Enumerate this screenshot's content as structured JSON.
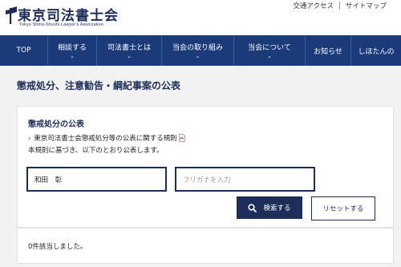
{
  "header": {
    "logo_title": "東京司法書士会",
    "logo_subtitle": "Tokyo Shiho-Shoshi Lawyer's Association",
    "util_links": [
      "交通アクセス",
      "サイトマップ"
    ]
  },
  "nav": {
    "items": [
      {
        "label": "TOP",
        "has_dropdown": false
      },
      {
        "label": "相談する",
        "has_dropdown": true
      },
      {
        "label": "司法書士とは",
        "has_dropdown": true
      },
      {
        "label": "当会の取り組み",
        "has_dropdown": true
      },
      {
        "label": "当会について",
        "has_dropdown": true
      },
      {
        "label": "お知らせ",
        "has_dropdown": false
      },
      {
        "label": "しほたんの",
        "has_dropdown": false
      }
    ],
    "chevron": "⌄"
  },
  "main": {
    "page_title": "懲戒処分、注意勧告・綱紀事案の公表",
    "section_title": "懲戒処分の公表",
    "rule_link": "東京司法書士会懲戒処分等の公表に関する規則",
    "description": "本規則に基づき、以下のとおり公表します。",
    "name_input_value": "和田　彰",
    "kana_input_placeholder": "フリガナを入力",
    "search_button": "検索する",
    "reset_button": "リセットする",
    "result_text": "0件該当しました。"
  },
  "icons": {
    "logo_mark": "flag-icon",
    "pdf": "pdf-icon",
    "search": "search-icon",
    "chevron_right": "chevron-right-icon"
  },
  "colors": {
    "brand_navy": "#1c2d5a",
    "nav_bg": "#1a3a7a",
    "page_bg": "#f2f2f2"
  }
}
